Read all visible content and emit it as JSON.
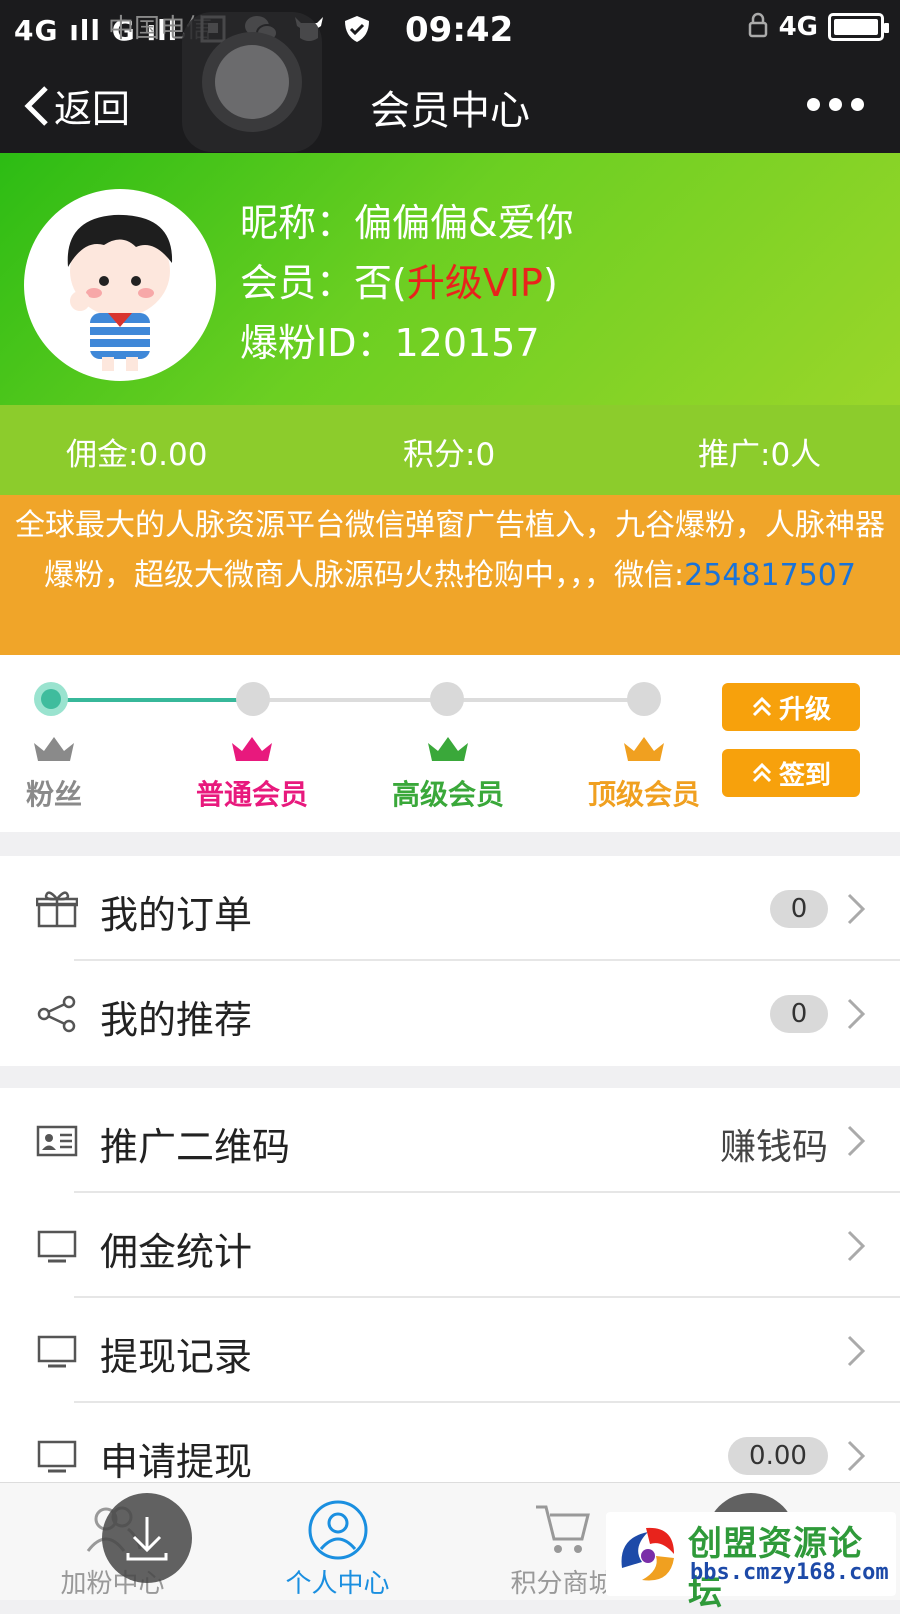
{
  "status_bar": {
    "signal": "4G ıll G ıll",
    "carrier": "中国电信",
    "time": "09:42",
    "network": "4G"
  },
  "nav": {
    "back_label": "返回",
    "title": "会员中心"
  },
  "profile": {
    "nickname_label": "昵称：",
    "nickname": "偏偏偏&爱你",
    "member_label": "会员：",
    "member_value": "否(",
    "upgrade_link": "升级VIP",
    "member_close": ")",
    "id_label": "爆粉ID：",
    "id_value": "120157"
  },
  "stats": {
    "commission": "佣金:0.00",
    "points": "积分:0",
    "promotion": "推广:0人"
  },
  "notice": {
    "text": "全球最大的人脉资源平台微信弹窗广告植入，九谷爆粉，人脉神器爆粉，超级大微商人脉源码火热抢购中，，，微信:",
    "wechat_id": "254817507"
  },
  "levels": {
    "progress": 0.33,
    "items": [
      {
        "label": "粉丝",
        "color": "#8a8a8a"
      },
      {
        "label": "普通会员",
        "color": "#e8197d"
      },
      {
        "label": "高级会员",
        "color": "#3aa83a"
      },
      {
        "label": "顶级会员",
        "color": "#f0a020"
      }
    ],
    "upgrade_button": "升级",
    "checkin_button": "签到"
  },
  "menu_group_1": [
    {
      "label": "我的订单",
      "badge": "0",
      "icon": "gift-icon"
    },
    {
      "label": "我的推荐",
      "badge": "0",
      "icon": "share-icon"
    }
  ],
  "menu_group_2": [
    {
      "label": "推广二维码",
      "right_text": "赚钱码",
      "icon": "id-card-icon"
    },
    {
      "label": "佣金统计",
      "icon": "monitor-icon"
    },
    {
      "label": "提现记录",
      "icon": "monitor-icon"
    },
    {
      "label": "申请提现",
      "badge": "0.00",
      "icon": "monitor-icon"
    }
  ],
  "tabbar": [
    {
      "label": "加粉中心",
      "icon": "users-icon",
      "active": false
    },
    {
      "label": "个人中心",
      "icon": "user-icon",
      "active": true
    },
    {
      "label": "积分商城",
      "icon": "cart-icon",
      "active": false
    }
  ],
  "watermark": {
    "title": "创盟资源论坛",
    "url": "bbs.cmzy168.com"
  },
  "colors": {
    "accent_green": "#6ccf22",
    "notice_orange": "#f0a529",
    "button_orange": "#f7a10c",
    "active_tab": "#1a8fe0",
    "upgrade_red": "#e8231c"
  }
}
